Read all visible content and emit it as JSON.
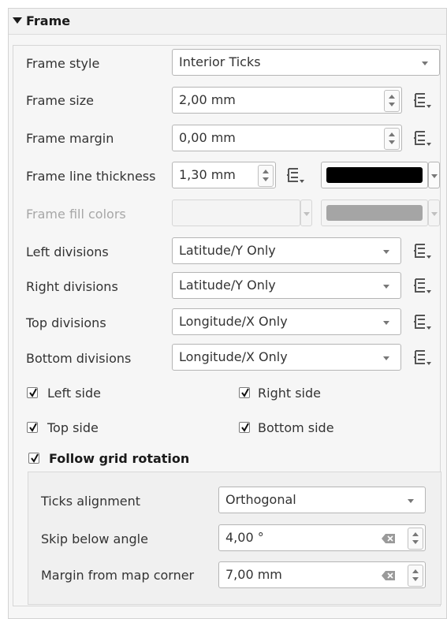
{
  "header": {
    "title": "Frame"
  },
  "rows": {
    "frame_style": {
      "label": "Frame style",
      "value": "Interior Ticks"
    },
    "frame_size": {
      "label": "Frame size",
      "value": "2,00 mm"
    },
    "frame_margin": {
      "label": "Frame margin",
      "value": "0,00 mm"
    },
    "frame_line_thickness": {
      "label": "Frame line thickness",
      "value": "1,30 mm",
      "color": "#000000"
    },
    "frame_fill_colors": {
      "label": "Frame fill colors",
      "color1": "#f4f4f4",
      "color2": "#a5a5a5"
    },
    "left_divisions": {
      "label": "Left divisions",
      "value": "Latitude/Y Only"
    },
    "right_divisions": {
      "label": "Right divisions",
      "value": "Latitude/Y Only"
    },
    "top_divisions": {
      "label": "Top divisions",
      "value": "Longitude/X Only"
    },
    "bottom_divisions": {
      "label": "Bottom divisions",
      "value": "Longitude/X Only"
    }
  },
  "sides": {
    "left": {
      "label": "Left side",
      "checked": true
    },
    "right": {
      "label": "Right side",
      "checked": true
    },
    "top": {
      "label": "Top side",
      "checked": true
    },
    "bottom": {
      "label": "Bottom side",
      "checked": true
    }
  },
  "follow_grid": {
    "label": "Follow grid rotation",
    "checked": true
  },
  "grid_rotation": {
    "ticks_alignment": {
      "label": "Ticks alignment",
      "value": "Orthogonal"
    },
    "skip_below_angle": {
      "label": "Skip below angle",
      "value": "4,00 °"
    },
    "margin_from_corner": {
      "label": "Margin from map corner",
      "value": "7,00 mm"
    }
  },
  "icons": {
    "data_defined": "data-defined-override-icon",
    "clear": "clear-icon",
    "collapse": "collapse-triangle-icon",
    "checkmark": "checkmark-icon"
  }
}
